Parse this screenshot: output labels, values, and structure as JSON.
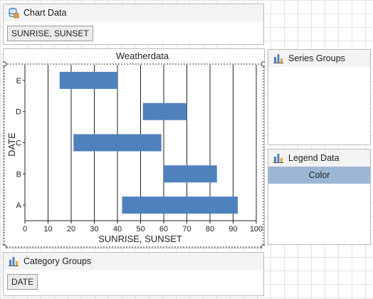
{
  "chart_data_panel": {
    "title": "Chart Data",
    "chip": "SUNRISE, SUNSET"
  },
  "series_groups_panel": {
    "title": "Series Groups"
  },
  "legend_data_panel": {
    "title": "Legend Data",
    "row": "Color"
  },
  "category_groups_panel": {
    "title": "Category Groups",
    "chip": "DATE"
  },
  "colors": {
    "bar": "#4f81bd",
    "legend_row": "#9cb6d6"
  },
  "chart_data": {
    "type": "bar",
    "orientation": "horizontal",
    "title": "Weatherdata",
    "xlabel": "SUNRISE, SUNSET",
    "ylabel": "DATE",
    "categories": [
      "A",
      "B",
      "C",
      "D",
      "E"
    ],
    "ranges": [
      [
        42,
        92
      ],
      [
        60,
        83
      ],
      [
        21,
        59
      ],
      [
        51,
        70
      ],
      [
        15,
        40
      ]
    ],
    "xlim": [
      0,
      100
    ],
    "xticks": [
      0,
      10,
      20,
      30,
      40,
      50,
      60,
      70,
      80,
      90,
      100
    ],
    "grid": "vertical"
  }
}
